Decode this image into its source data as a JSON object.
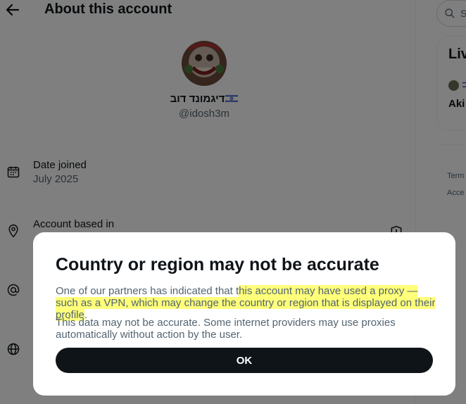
{
  "header": {
    "title": "About this account"
  },
  "profile": {
    "display_name": "דיגמונד דוב",
    "handle": "@idosh3m"
  },
  "rows": [
    {
      "label": "Date joined",
      "value": "July 2025",
      "icon": "calendar-icon"
    },
    {
      "label": "Account based in",
      "icon": "location-pin-icon"
    }
  ],
  "sidebar": {
    "search_placeholder": "S",
    "live_title": "Liv",
    "live_host": "Aki",
    "footer_links": [
      "Term",
      "Acce"
    ]
  },
  "modal": {
    "title": "Country or region may not be accurate",
    "body1_plain": "One of our partners has indicated that t",
    "body1_highlight": "his account may have used a proxy — such as a VPN, which may change the country or region that is displayed on their profile",
    "body1_end": ".",
    "body2": "This data may not be accurate. Some internet providers may use proxies automatically without action by the user.",
    "ok_label": "OK"
  },
  "colors": {
    "overlay": "rgba(0,0,0,0.5)",
    "button_bg": "#0f1419",
    "highlight": "#ffff7a",
    "secondary_text": "#536471"
  }
}
